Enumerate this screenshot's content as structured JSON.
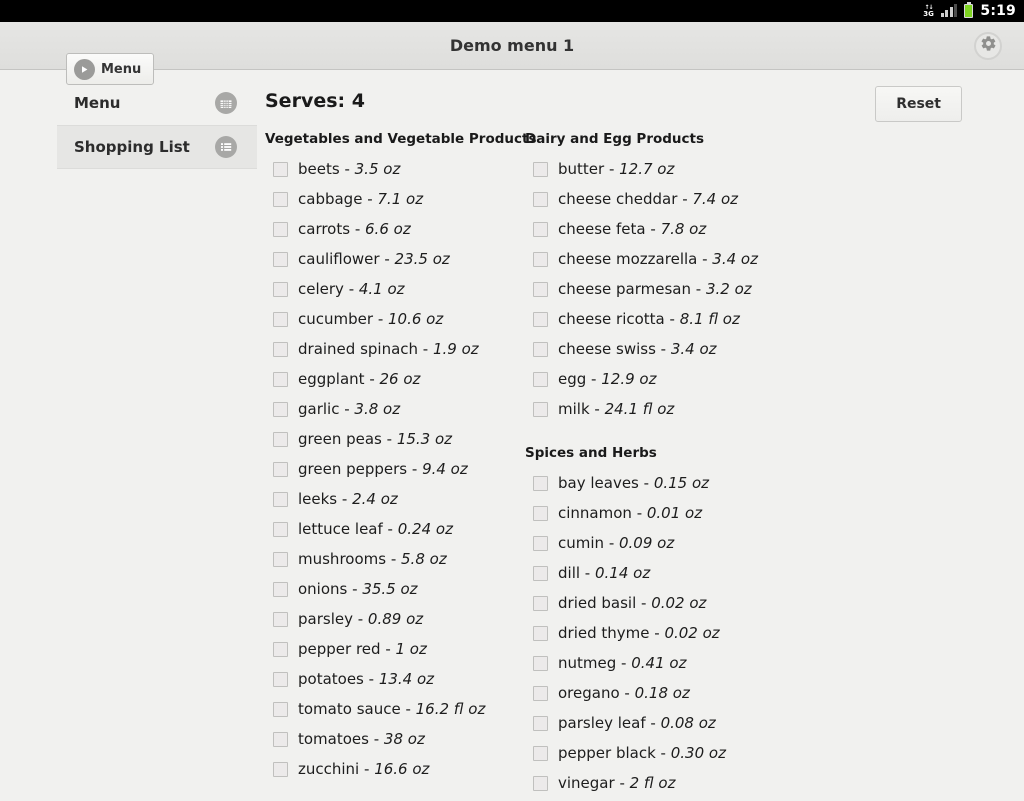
{
  "statusbar": {
    "network": "3G",
    "time": "5:19",
    "battery_icon": "battery-icon",
    "signal_icon": "signal-bars-icon"
  },
  "actionbar": {
    "menu_button_label": "Menu",
    "menu_button_icon": "up-arrow-circle-icon",
    "title": "Demo menu 1",
    "settings_icon": "gear-icon"
  },
  "sidebar": {
    "items": [
      {
        "label": "Menu",
        "icon": "calendar-grid-icon",
        "selected": false
      },
      {
        "label": "Shopping List",
        "icon": "list-lines-icon",
        "selected": true
      }
    ]
  },
  "main": {
    "serves_label": "Serves: 4",
    "reset_label": "Reset",
    "columns": [
      {
        "groups": [
          {
            "title": "Vegetables and Vegetable Products",
            "items": [
              {
                "name": "beets",
                "qty": "3.5 oz",
                "checked": false
              },
              {
                "name": "cabbage",
                "qty": "7.1 oz",
                "checked": false
              },
              {
                "name": "carrots",
                "qty": "6.6 oz",
                "checked": false
              },
              {
                "name": "cauliflower",
                "qty": "23.5 oz",
                "checked": false
              },
              {
                "name": "celery",
                "qty": "4.1 oz",
                "checked": false
              },
              {
                "name": "cucumber",
                "qty": "10.6 oz",
                "checked": false
              },
              {
                "name": "drained spinach",
                "qty": "1.9 oz",
                "checked": false
              },
              {
                "name": "eggplant",
                "qty": "26 oz",
                "checked": false
              },
              {
                "name": "garlic",
                "qty": "3.8 oz",
                "checked": false
              },
              {
                "name": "green peas",
                "qty": "15.3 oz",
                "checked": false
              },
              {
                "name": "green peppers",
                "qty": "9.4 oz",
                "checked": false
              },
              {
                "name": "leeks",
                "qty": "2.4 oz",
                "checked": false
              },
              {
                "name": "lettuce leaf",
                "qty": "0.24 oz",
                "checked": false
              },
              {
                "name": "mushrooms",
                "qty": "5.8 oz",
                "checked": false
              },
              {
                "name": "onions",
                "qty": "35.5 oz",
                "checked": false
              },
              {
                "name": "parsley",
                "qty": "0.89 oz",
                "checked": false
              },
              {
                "name": "pepper red",
                "qty": "1 oz",
                "checked": false
              },
              {
                "name": "potatoes",
                "qty": "13.4 oz",
                "checked": false
              },
              {
                "name": "tomato sauce",
                "qty": "16.2 fl oz",
                "checked": false
              },
              {
                "name": "tomatoes",
                "qty": "38 oz",
                "checked": false
              },
              {
                "name": "zucchini",
                "qty": "16.6 oz",
                "checked": false
              }
            ]
          }
        ]
      },
      {
        "groups": [
          {
            "title": "Dairy and Egg Products",
            "items": [
              {
                "name": "butter",
                "qty": "12.7 oz",
                "checked": false
              },
              {
                "name": "cheese cheddar",
                "qty": "7.4 oz",
                "checked": false
              },
              {
                "name": "cheese feta",
                "qty": "7.8 oz",
                "checked": false
              },
              {
                "name": "cheese mozzarella",
                "qty": "3.4 oz",
                "checked": false
              },
              {
                "name": "cheese parmesan",
                "qty": "3.2 oz",
                "checked": false
              },
              {
                "name": "cheese ricotta",
                "qty": "8.1 fl oz",
                "checked": false
              },
              {
                "name": "cheese swiss",
                "qty": "3.4 oz",
                "checked": false
              },
              {
                "name": "egg",
                "qty": "12.9 oz",
                "checked": false
              },
              {
                "name": "milk",
                "qty": "24.1 fl oz",
                "checked": false
              }
            ]
          },
          {
            "title": "Spices and Herbs",
            "items": [
              {
                "name": "bay leaves",
                "qty": "0.15 oz",
                "checked": false
              },
              {
                "name": "cinnamon",
                "qty": "0.01 oz",
                "checked": false
              },
              {
                "name": "cumin",
                "qty": "0.09 oz",
                "checked": false
              },
              {
                "name": "dill",
                "qty": "0.14 oz",
                "checked": false
              },
              {
                "name": "dried basil",
                "qty": "0.02 oz",
                "checked": false
              },
              {
                "name": "dried thyme",
                "qty": "0.02 oz",
                "checked": false
              },
              {
                "name": "nutmeg",
                "qty": "0.41 oz",
                "checked": false
              },
              {
                "name": "oregano",
                "qty": "0.18 oz",
                "checked": false
              },
              {
                "name": "parsley leaf",
                "qty": "0.08 oz",
                "checked": false
              },
              {
                "name": "pepper black",
                "qty": "0.30 oz",
                "checked": false
              },
              {
                "name": "vinegar",
                "qty": "2 fl oz",
                "checked": false
              }
            ]
          }
        ]
      }
    ]
  },
  "colors": {
    "page_bg": "#f1f1ef",
    "actionbar_bg": "#e2e2e0",
    "selected_item_bg": "#e6e6e4",
    "statusbar_bg": "#000000",
    "battery_green": "#7ed321"
  }
}
